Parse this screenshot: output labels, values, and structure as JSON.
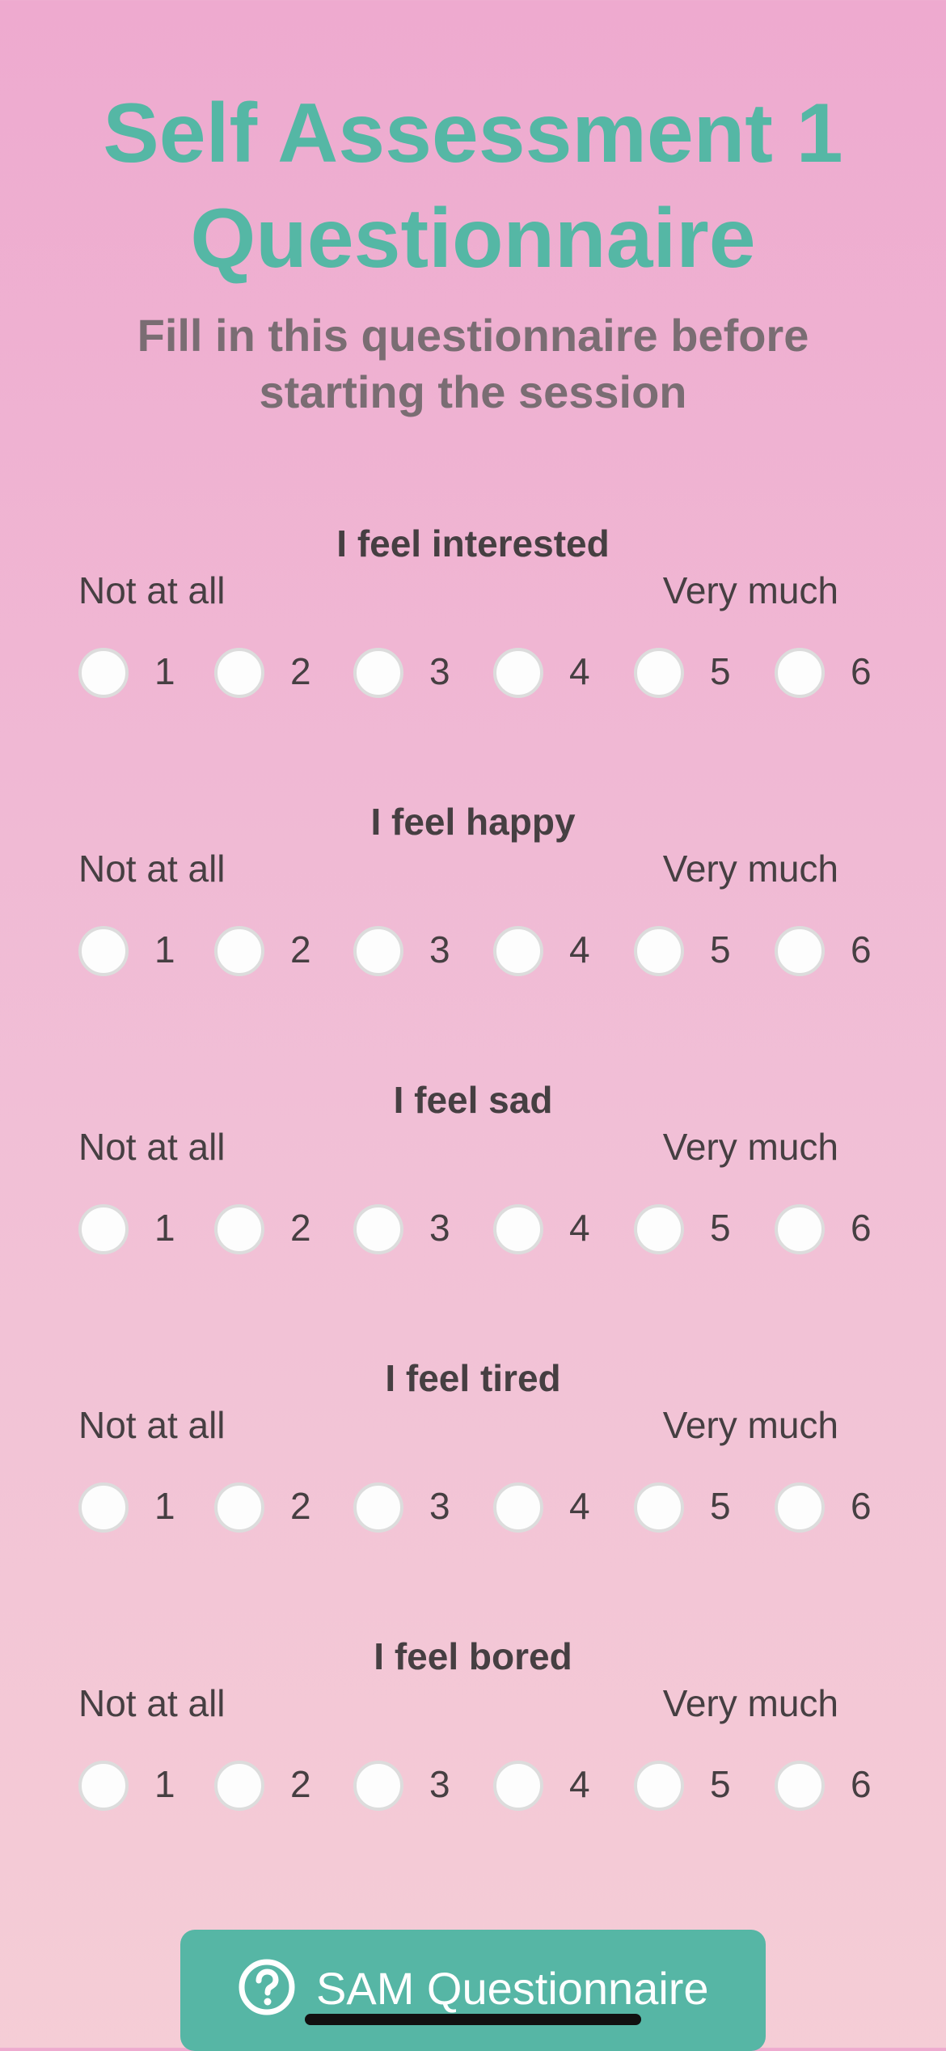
{
  "header": {
    "title_line1": "Self Assessment 1",
    "title_line2": "Questionnaire",
    "subtitle_line1": "Fill in this questionnaire before",
    "subtitle_line2": "starting the session"
  },
  "questions": [
    {
      "label": "I feel interested",
      "min_label": "Not at all",
      "max_label": "Very much",
      "options": [
        "1",
        "2",
        "3",
        "4",
        "5",
        "6"
      ]
    },
    {
      "label": "I feel happy",
      "min_label": "Not at all",
      "max_label": "Very much",
      "options": [
        "1",
        "2",
        "3",
        "4",
        "5",
        "6"
      ]
    },
    {
      "label": "I feel sad",
      "min_label": "Not at all",
      "max_label": "Very much",
      "options": [
        "1",
        "2",
        "3",
        "4",
        "5",
        "6"
      ]
    },
    {
      "label": "I feel tired",
      "min_label": "Not at all",
      "max_label": "Very much",
      "options": [
        "1",
        "2",
        "3",
        "4",
        "5",
        "6"
      ]
    },
    {
      "label": "I feel bored",
      "min_label": "Not at all",
      "max_label": "Very much",
      "options": [
        "1",
        "2",
        "3",
        "4",
        "5",
        "6"
      ]
    }
  ],
  "footer": {
    "sam_button_label": "SAM Questionnaire",
    "sam_button_icon": "question-circle-icon"
  },
  "colors": {
    "accent": "#55b7a5",
    "background_top": "#eeaacf",
    "background_bottom": "#f5cdd6",
    "text": "#463f42",
    "subtitle": "#7a6d73"
  }
}
